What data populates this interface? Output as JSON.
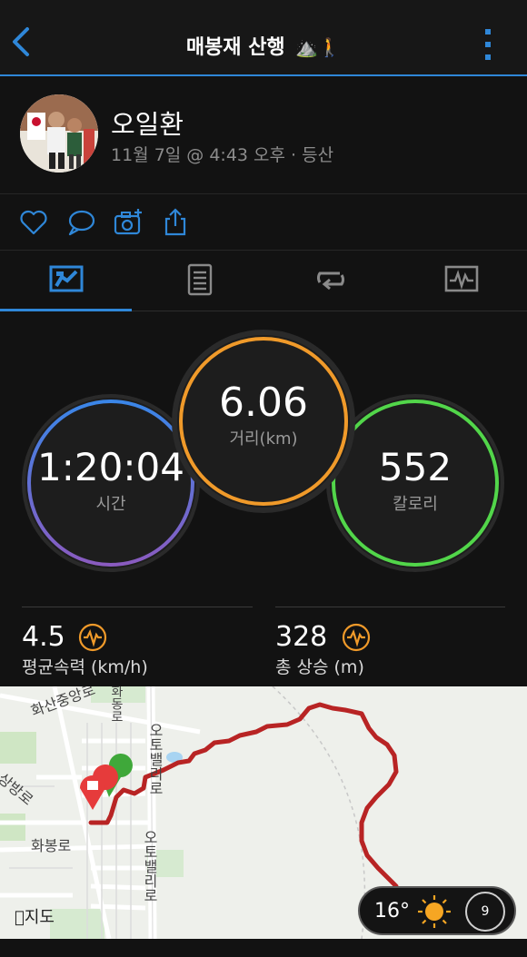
{
  "header": {
    "title": "매봉재 산행",
    "title_emoji": "⛰️🚶",
    "accent": "#2f87d8"
  },
  "user": {
    "name": "오일환",
    "meta": "11월 7일 @ 4:43 오후 · 등산"
  },
  "actions": [
    "heart-icon",
    "comment-icon",
    "camera-add-icon",
    "share-icon"
  ],
  "tabs": [
    "overview-tab",
    "details-tab",
    "laps-tab",
    "charts-tab"
  ],
  "rings": {
    "time": {
      "value": "1:20:04",
      "label": "시간"
    },
    "distance": {
      "value": "6.06",
      "label": "거리(km)"
    },
    "calories": {
      "value": "552",
      "label": "칼로리"
    }
  },
  "stats": {
    "avg_speed": {
      "value": "4.5",
      "label": "평균속력 (km/h)"
    },
    "elevation_gain": {
      "value": "328",
      "label": "총 상승 (m)"
    }
  },
  "map": {
    "labels": {
      "hwasan": "화산중앙로",
      "otobaelli1": "오토밸리로",
      "otobaelli2": "오토밸리로",
      "sangbang": "상방로",
      "hwabong": "화봉로",
      "hwadong": "화동로"
    },
    "attribution": "지도",
    "weather": {
      "temp": "16°",
      "wind": "9"
    }
  }
}
